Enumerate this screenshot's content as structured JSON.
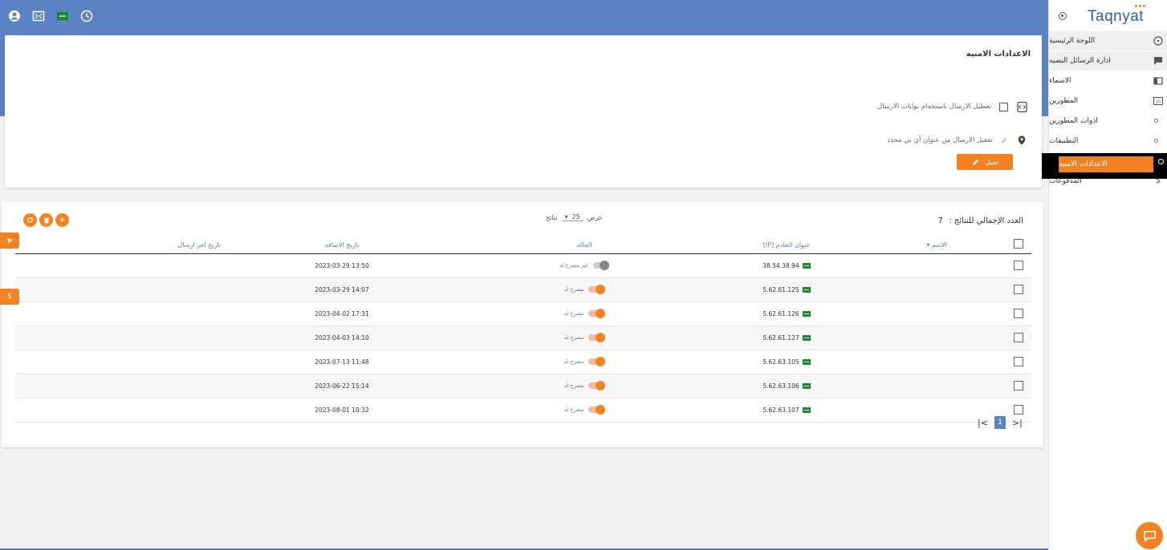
{
  "brand": {
    "logo_text": "Taqnyat",
    "accent": "#f58220",
    "primary": "#5b82c4"
  },
  "topbar": {
    "icons": [
      "user-circle-icon",
      "expand-icon",
      "flag-icon",
      "clock-icon"
    ]
  },
  "sidebar": {
    "items": [
      {
        "label": "اللوحة الرئيسية",
        "icon": "dashboard-icon"
      },
      {
        "label": "ادارة الرسائل النصيه",
        "icon": "message-icon"
      },
      {
        "label": "الاسماء",
        "icon": "book-icon"
      },
      {
        "label": "المطورين",
        "icon": "code-icon"
      },
      {
        "label": "ادوات المطورين"
      },
      {
        "label": "التطبيقات"
      },
      {
        "label": "الاعدادات الامنيه"
      },
      {
        "label": "المدفوعات",
        "icon": "dollar-icon"
      }
    ]
  },
  "settings": {
    "title": "الاعدادات الامنيه",
    "option1": "تعطيل الارسال باستخدام بوابات الارسال",
    "option2": "تفعيل الارسال من عنوان آي بي محدد",
    "edit_label": "تحيل"
  },
  "table": {
    "total_label": "العدد الإجمالي للنتائج :",
    "total_count": "7",
    "show_label": "عرض",
    "page_size": "25",
    "results_label": "نتائج",
    "columns": [
      "الاسم",
      "عنوان الخادم [IP]",
      "الحاله",
      "تاريخ الاضافه",
      "تاريخ اخر ارسال"
    ],
    "rows": [
      {
        "ip": "38.54.38.94",
        "status": "غير مصرح له",
        "enabled": false,
        "added": "13:50 2023-03-29",
        "last": ""
      },
      {
        "ip": "5.62.61.125",
        "status": "مصرح له",
        "enabled": true,
        "added": "14:07 2023-03-29",
        "last": ""
      },
      {
        "ip": "5.62.61.126",
        "status": "مصرح له",
        "enabled": true,
        "added": "17:31 2023-04-02",
        "last": ""
      },
      {
        "ip": "5.62.61.127",
        "status": "مصرح له",
        "enabled": true,
        "added": "14:10 2023-04-03",
        "last": ""
      },
      {
        "ip": "5.62.63.105",
        "status": "مصرح له",
        "enabled": true,
        "added": "11:48 2023-07-13",
        "last": ""
      },
      {
        "ip": "5.62.63.106",
        "status": "مصرح له",
        "enabled": true,
        "added": "15:14 2023-06-22",
        "last": ""
      },
      {
        "ip": "5.62.63.107",
        "status": "مصرح له",
        "enabled": true,
        "added": "10:32 2023-08-01",
        "last": ""
      }
    ]
  },
  "pagination": {
    "current_page": "1",
    "first_label": "|<",
    "last_label": ">|"
  },
  "floating": {
    "cursor_tab": "cursor-icon",
    "payment_tab": "$"
  }
}
